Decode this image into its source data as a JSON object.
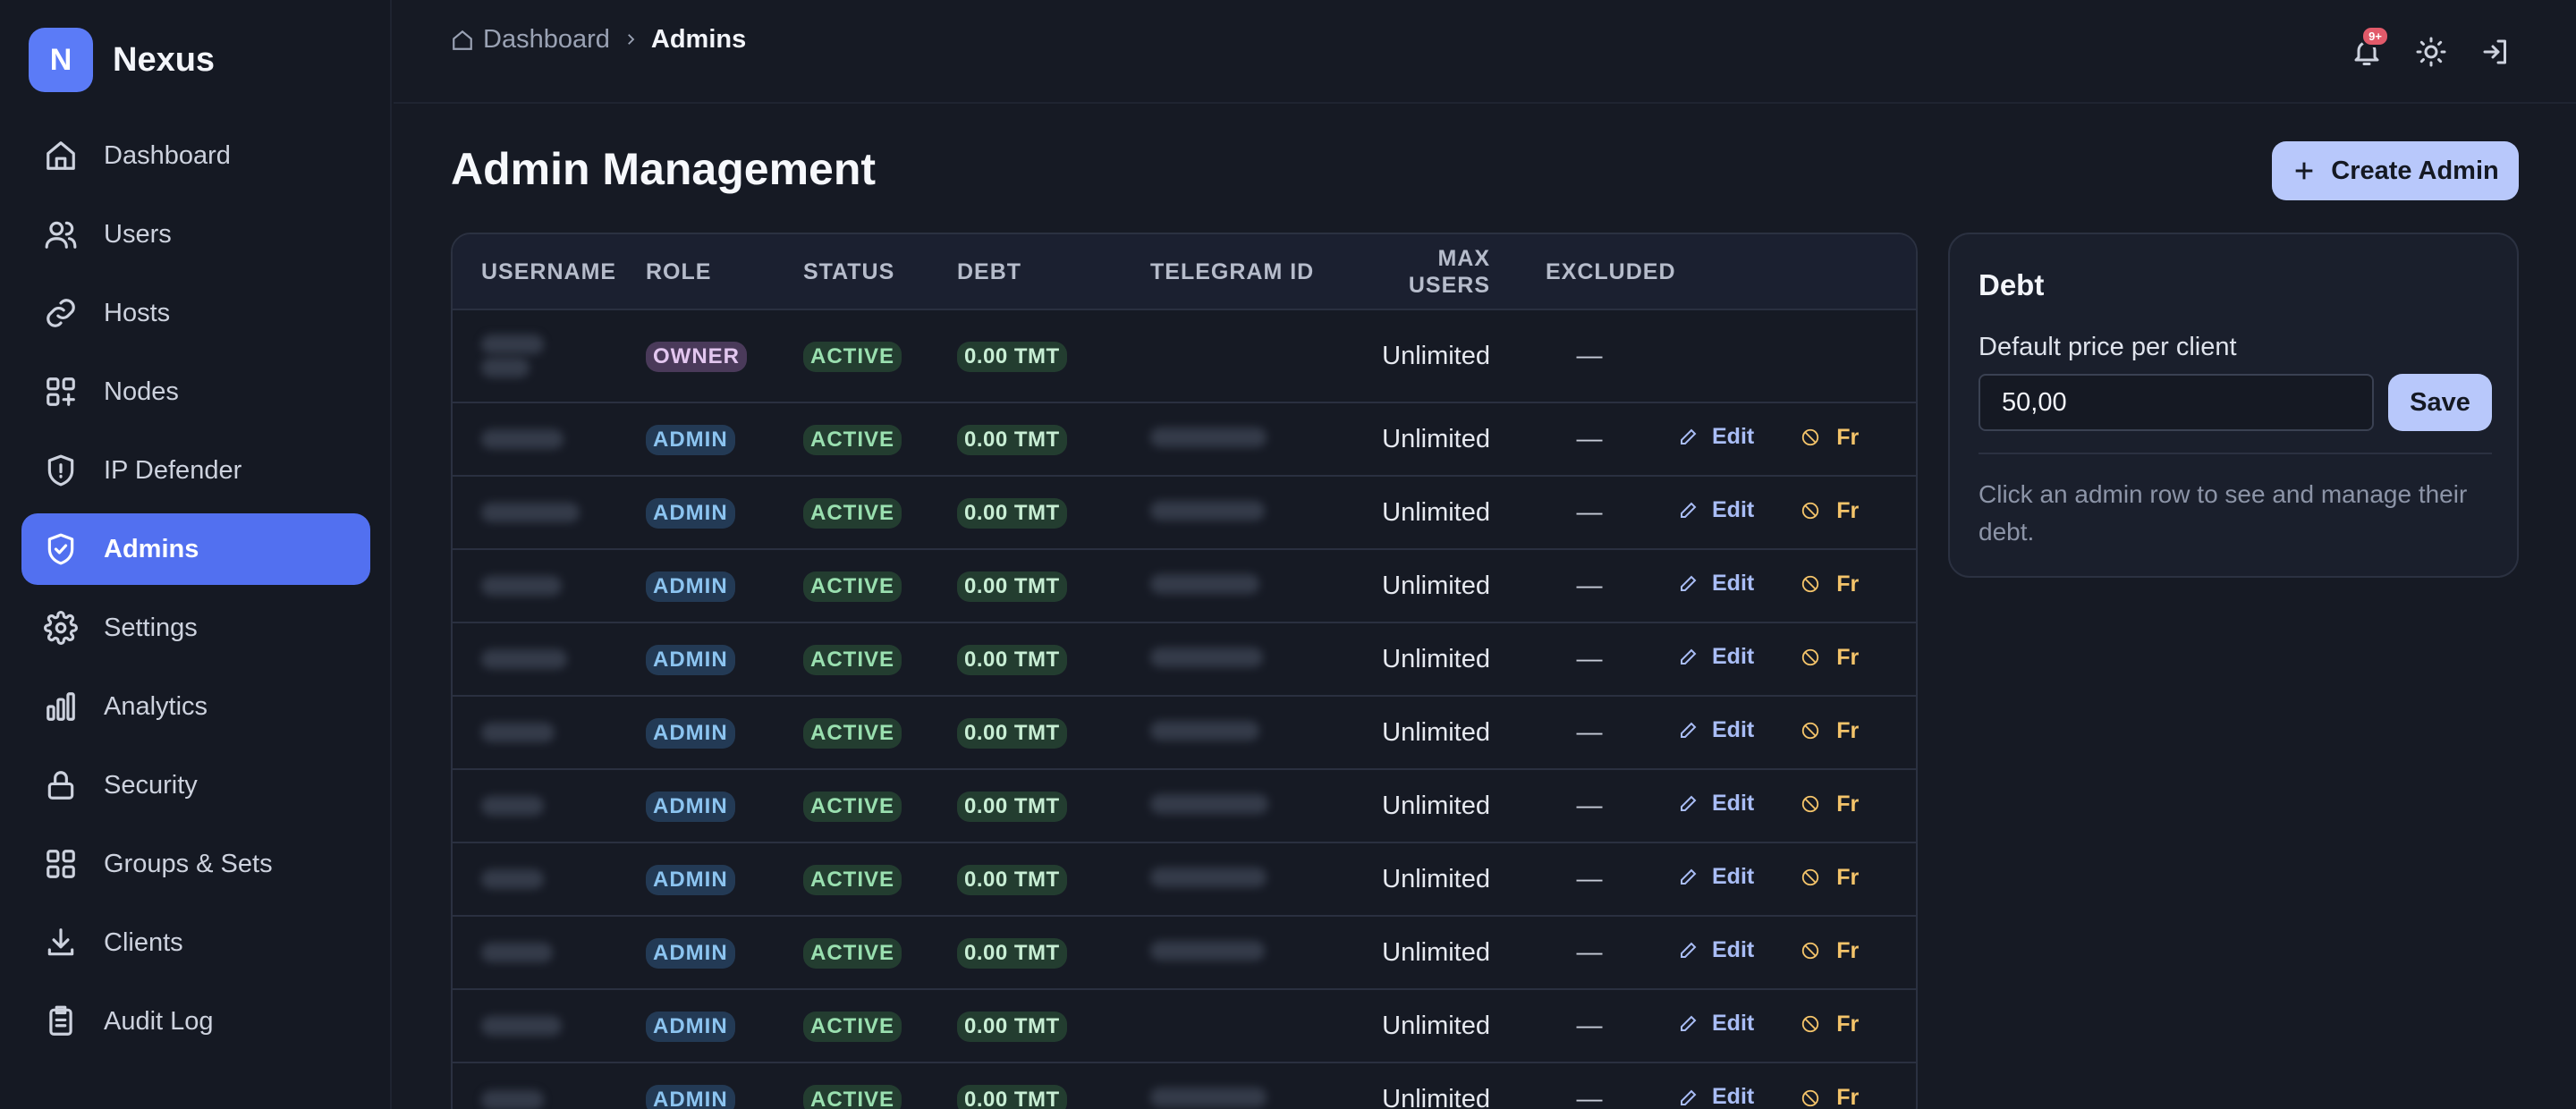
{
  "brand": {
    "logo_letter": "N",
    "name": "Nexus"
  },
  "sidebar": {
    "items": [
      {
        "label": "Dashboard",
        "icon": "home-icon"
      },
      {
        "label": "Users",
        "icon": "users-icon"
      },
      {
        "label": "Hosts",
        "icon": "link-icon"
      },
      {
        "label": "Nodes",
        "icon": "nodes-icon"
      },
      {
        "label": "IP Defender",
        "icon": "shield-alert-icon"
      },
      {
        "label": "Admins",
        "icon": "shield-check-icon",
        "active": true
      },
      {
        "label": "Settings",
        "icon": "gear-icon"
      },
      {
        "label": "Analytics",
        "icon": "bar-chart-icon"
      },
      {
        "label": "Security",
        "icon": "lock-icon"
      },
      {
        "label": "Groups & Sets",
        "icon": "grid-icon"
      },
      {
        "label": "Clients",
        "icon": "download-icon"
      },
      {
        "label": "Audit Log",
        "icon": "clipboard-icon"
      }
    ]
  },
  "header": {
    "breadcrumb": {
      "home": "Dashboard",
      "current": "Admins"
    },
    "notification_badge": "9+"
  },
  "main": {
    "title": "Admin Management",
    "create_button": "Create Admin"
  },
  "table": {
    "columns": [
      "USERNAME",
      "ROLE",
      "STATUS",
      "DEBT",
      "TELEGRAM ID",
      "MAX USERS",
      "EXCLUDED"
    ],
    "rows": [
      {
        "role": "OWNER",
        "status": "ACTIVE",
        "debt": "0.00 TMT",
        "max_users": "Unlimited",
        "excluded": "—"
      },
      {
        "role": "ADMIN",
        "status": "ACTIVE",
        "debt": "0.00 TMT",
        "max_users": "Unlimited",
        "excluded": "—"
      },
      {
        "role": "ADMIN",
        "status": "ACTIVE",
        "debt": "0.00 TMT",
        "max_users": "Unlimited",
        "excluded": "—"
      },
      {
        "role": "ADMIN",
        "status": "ACTIVE",
        "debt": "0.00 TMT",
        "max_users": "Unlimited",
        "excluded": "—"
      },
      {
        "role": "ADMIN",
        "status": "ACTIVE",
        "debt": "0.00 TMT",
        "max_users": "Unlimited",
        "excluded": "—"
      },
      {
        "role": "ADMIN",
        "status": "ACTIVE",
        "debt": "0.00 TMT",
        "max_users": "Unlimited",
        "excluded": "—"
      },
      {
        "role": "ADMIN",
        "status": "ACTIVE",
        "debt": "0.00 TMT",
        "max_users": "Unlimited",
        "excluded": "—"
      },
      {
        "role": "ADMIN",
        "status": "ACTIVE",
        "debt": "0.00 TMT",
        "max_users": "Unlimited",
        "excluded": "—"
      },
      {
        "role": "ADMIN",
        "status": "ACTIVE",
        "debt": "0.00 TMT",
        "max_users": "Unlimited",
        "excluded": "—"
      },
      {
        "role": "ADMIN",
        "status": "ACTIVE",
        "debt": "0.00 TMT",
        "max_users": "Unlimited",
        "excluded": "—"
      },
      {
        "role": "ADMIN",
        "status": "ACTIVE",
        "debt": "0.00 TMT",
        "max_users": "Unlimited",
        "excluded": "—"
      }
    ],
    "actions": {
      "edit": "Edit",
      "free": "Fr"
    }
  },
  "debt_panel": {
    "title": "Debt",
    "label": "Default price per client",
    "value": "50,00",
    "save": "Save",
    "hint": "Click an admin row to see and manage their debt."
  },
  "colors": {
    "accent": "#5270f0",
    "button": "#b8c8fb",
    "background": "#161a24"
  }
}
